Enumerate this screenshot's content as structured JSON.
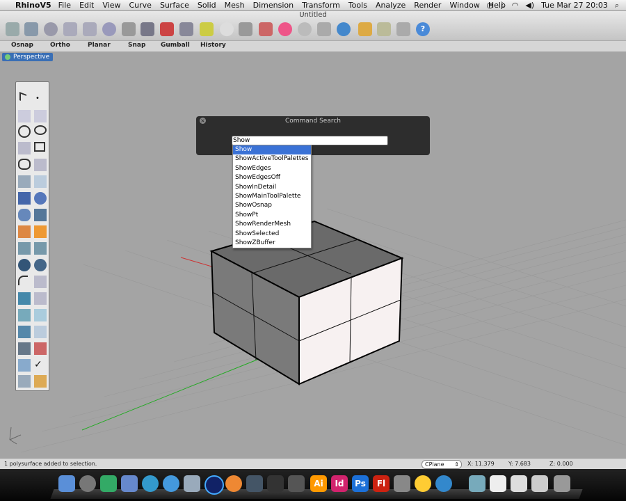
{
  "menubar": {
    "apple": "",
    "app": "RhinoV5",
    "items": [
      "File",
      "Edit",
      "View",
      "Curve",
      "Surface",
      "Solid",
      "Mesh",
      "Dimension",
      "Transform",
      "Tools",
      "Analyze",
      "Render",
      "Window",
      "Help"
    ],
    "clock": "Tue Mar 27  20:03"
  },
  "window": {
    "title": "Untitled"
  },
  "options": [
    "Osnap",
    "Ortho",
    "Planar",
    "Snap",
    "Gumball",
    "History"
  ],
  "viewport": {
    "label": "Perspective"
  },
  "command_search": {
    "title": "Command Search",
    "query": "Show",
    "suggestions": [
      "Show",
      "ShowActiveToolPalettes",
      "ShowEdges",
      "ShowEdgesOff",
      "ShowInDetail",
      "ShowMainToolPalette",
      "ShowOsnap",
      "ShowPt",
      "ShowRenderMesh",
      "ShowSelected",
      "ShowZBuffer"
    ],
    "selected_index": 0
  },
  "status": {
    "message": "1 polysurface added to selection.",
    "cplane": "CPlane",
    "x": "X: 11.379",
    "y": "Y: 7.683",
    "z": "Z: 0.000"
  },
  "dock": {
    "labels": [
      "Ai",
      "Id",
      "Ps",
      "Fl"
    ]
  },
  "colors": {
    "selection": "#3a72d6",
    "viewport_bg": "#a4a4a4"
  }
}
